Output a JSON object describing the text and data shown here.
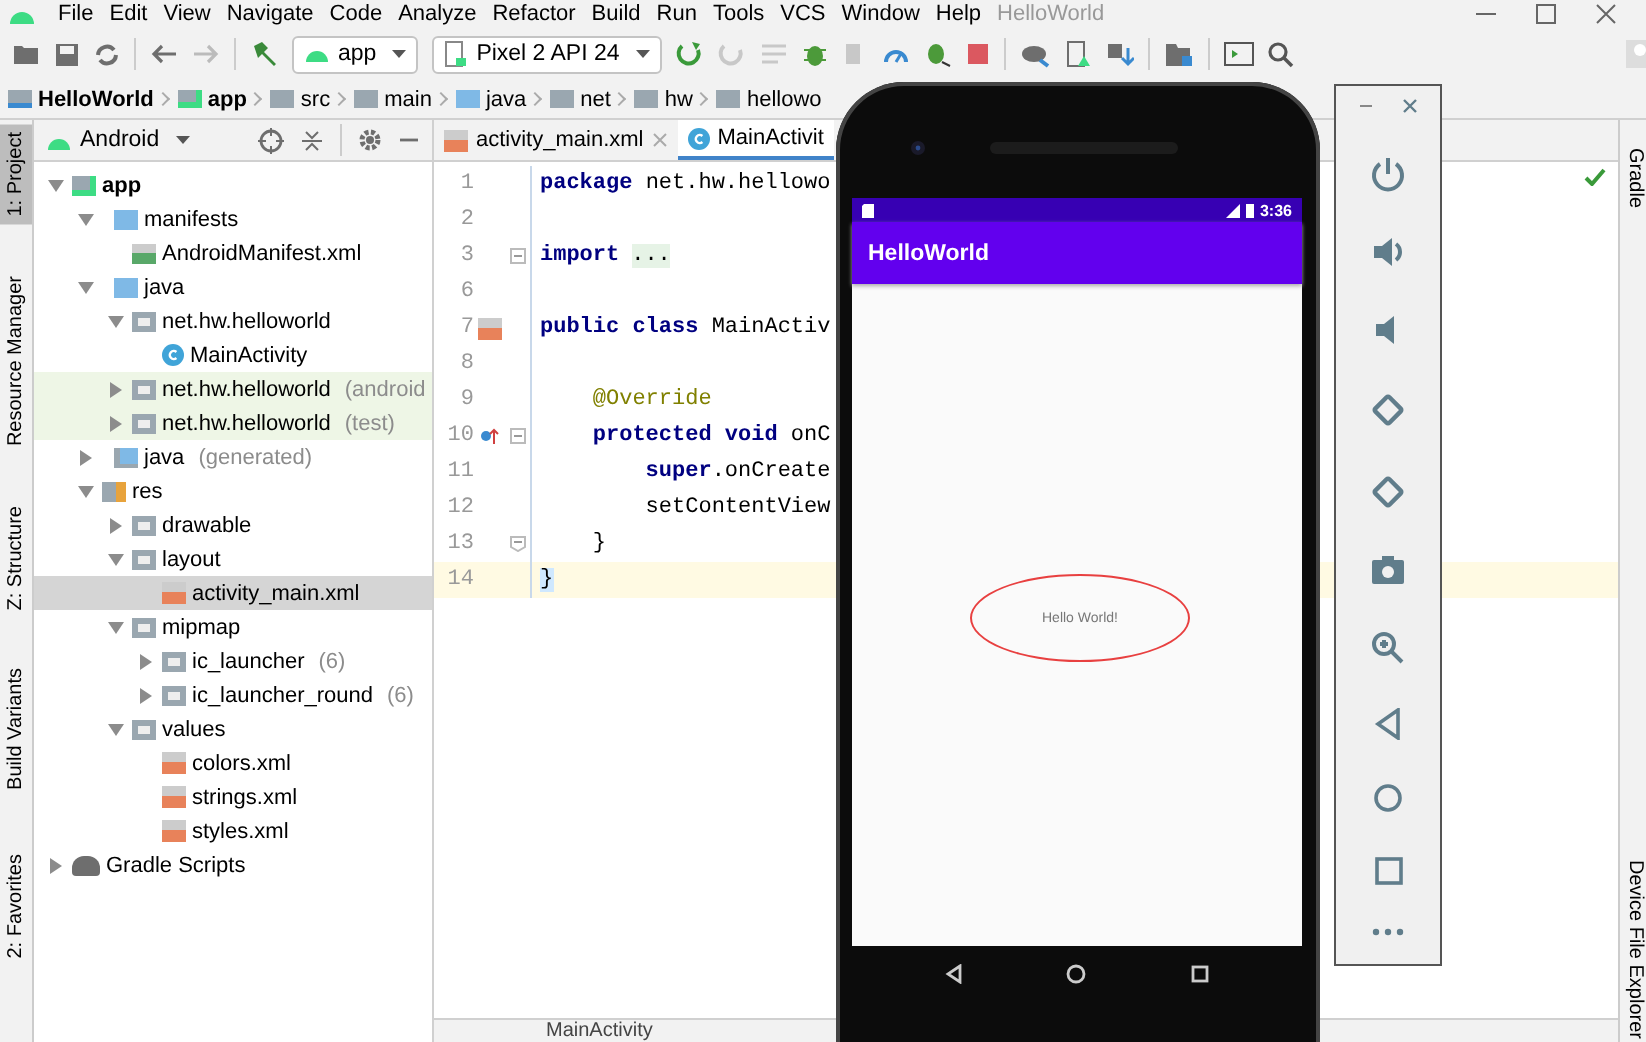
{
  "window": {
    "title": "HelloWorld"
  },
  "menu": [
    "File",
    "Edit",
    "View",
    "Navigate",
    "Code",
    "Analyze",
    "Refactor",
    "Build",
    "Run",
    "Tools",
    "VCS",
    "Window",
    "Help"
  ],
  "toolbar": {
    "configuration": "app",
    "device": "Pixel 2 API 24"
  },
  "breadcrumb": [
    {
      "label": "HelloWorld",
      "bold": true,
      "kind": "project"
    },
    {
      "label": "app",
      "bold": true,
      "kind": "module"
    },
    {
      "label": "src",
      "bold": false,
      "kind": "folder"
    },
    {
      "label": "main",
      "bold": false,
      "kind": "folder"
    },
    {
      "label": "java",
      "bold": false,
      "kind": "source"
    },
    {
      "label": "net",
      "bold": false,
      "kind": "folder"
    },
    {
      "label": "hw",
      "bold": false,
      "kind": "folder"
    },
    {
      "label": "hellowo",
      "bold": false,
      "kind": "folder"
    }
  ],
  "left_stripe": [
    {
      "label": "1: Project",
      "selected": true
    },
    {
      "label": "Resource Manager",
      "selected": false
    },
    {
      "label": "Z: Structure",
      "selected": false
    },
    {
      "label": "Build Variants",
      "selected": false
    },
    {
      "label": "2: Favorites",
      "selected": false
    }
  ],
  "project": {
    "view": "Android",
    "tree": [
      {
        "label": "app",
        "kind": "module",
        "bold": true,
        "expanded": true,
        "selected": false,
        "highlighted": false,
        "children": [
          {
            "label": "manifests",
            "kind": "folder",
            "expanded": true,
            "selected": false,
            "highlighted": false,
            "children": [
              {
                "label": "AndroidManifest.xml",
                "kind": "manifest",
                "selected": false,
                "highlighted": false
              }
            ]
          },
          {
            "label": "java",
            "kind": "folder",
            "expanded": true,
            "selected": false,
            "highlighted": false,
            "children": [
              {
                "label": "net.hw.helloworld",
                "kind": "package",
                "expanded": true,
                "selected": false,
                "highlighted": false,
                "children": [
                  {
                    "label": "MainActivity",
                    "kind": "class",
                    "selected": false,
                    "highlighted": false
                  }
                ]
              },
              {
                "label": "net.hw.helloworld",
                "suffix": "(android",
                "kind": "package",
                "expanded": false,
                "selected": false,
                "highlighted": true
              },
              {
                "label": "net.hw.helloworld",
                "suffix": "(test)",
                "kind": "package",
                "expanded": false,
                "selected": false,
                "highlighted": true
              }
            ]
          },
          {
            "label": "java",
            "suffix": "(generated)",
            "kind": "generated",
            "expanded": false,
            "selected": false,
            "highlighted": false
          },
          {
            "label": "res",
            "kind": "res",
            "expanded": true,
            "selected": false,
            "highlighted": false,
            "children": [
              {
                "label": "drawable",
                "kind": "package",
                "expanded": false,
                "selected": false,
                "highlighted": false
              },
              {
                "label": "layout",
                "kind": "package",
                "expanded": true,
                "selected": false,
                "highlighted": false,
                "children": [
                  {
                    "label": "activity_main.xml",
                    "kind": "xml",
                    "selected": true,
                    "highlighted": false
                  }
                ]
              },
              {
                "label": "mipmap",
                "kind": "package",
                "expanded": true,
                "selected": false,
                "highlighted": false,
                "children": [
                  {
                    "label": "ic_launcher",
                    "suffix": "(6)",
                    "kind": "package",
                    "expanded": false,
                    "selected": false,
                    "highlighted": false
                  },
                  {
                    "label": "ic_launcher_round",
                    "suffix": "(6)",
                    "kind": "package",
                    "expanded": false,
                    "selected": false,
                    "highlighted": false
                  }
                ]
              },
              {
                "label": "values",
                "kind": "package",
                "expanded": true,
                "selected": false,
                "highlighted": false,
                "children": [
                  {
                    "label": "colors.xml",
                    "kind": "xml",
                    "selected": false,
                    "highlighted": false
                  },
                  {
                    "label": "strings.xml",
                    "kind": "xml",
                    "selected": false,
                    "highlighted": false
                  },
                  {
                    "label": "styles.xml",
                    "kind": "xml",
                    "selected": false,
                    "highlighted": false
                  }
                ]
              }
            ]
          }
        ]
      },
      {
        "label": "Gradle Scripts",
        "kind": "gradle",
        "expanded": false,
        "selected": false,
        "highlighted": false
      }
    ]
  },
  "editor": {
    "tabs": [
      {
        "label": "activity_main.xml",
        "kind": "xml",
        "selected": false
      },
      {
        "label": "MainActivit",
        "kind": "class",
        "selected": true
      }
    ],
    "lines": [
      {
        "number": "1",
        "tokens": [
          {
            "text": "package",
            "kind": "keyword"
          },
          {
            "text": " net.hw.hellowo",
            "kind": "plain"
          }
        ]
      },
      {
        "number": "2"
      },
      {
        "number": "3",
        "fold_start": true,
        "tokens": [
          {
            "text": "import",
            "kind": "keyword"
          },
          {
            "text": "...",
            "kind": "folded"
          }
        ]
      },
      {
        "number": "6"
      },
      {
        "number": "7",
        "layout_marker": true,
        "tokens": [
          {
            "text": "public class",
            "kind": "keyword"
          },
          {
            "text": " MainActiv",
            "kind": "plain"
          }
        ]
      },
      {
        "number": "8"
      },
      {
        "number": "9",
        "tokens": [
          {
            "text": "    @Override",
            "kind": "annotation"
          }
        ]
      },
      {
        "number": "10",
        "override_marker": true,
        "fold_start": true,
        "tokens": [
          {
            "text": "    protected void",
            "kind": "keyword"
          },
          {
            "text": " onC",
            "kind": "plain"
          }
        ]
      },
      {
        "number": "11",
        "tokens": [
          {
            "text": "        super",
            "kind": "keyword"
          },
          {
            "text": ".onCreate",
            "kind": "plain"
          }
        ]
      },
      {
        "number": "12",
        "tokens": [
          {
            "text": "        setContentView",
            "kind": "plain"
          }
        ]
      },
      {
        "number": "13",
        "fold_end": true,
        "tokens": [
          {
            "text": "    }",
            "kind": "plain"
          }
        ]
      },
      {
        "number": "14",
        "current": true,
        "tokens": [
          {
            "text": "}",
            "kind": "brace"
          }
        ]
      }
    ]
  },
  "right_stripe": [
    "Gradle",
    "Device File Explorer"
  ],
  "status_bar": {
    "breadcrumb": "MainActivity"
  },
  "emulator": {
    "time": "3:36",
    "app_title": "HelloWorld",
    "content": "Hello World!"
  }
}
